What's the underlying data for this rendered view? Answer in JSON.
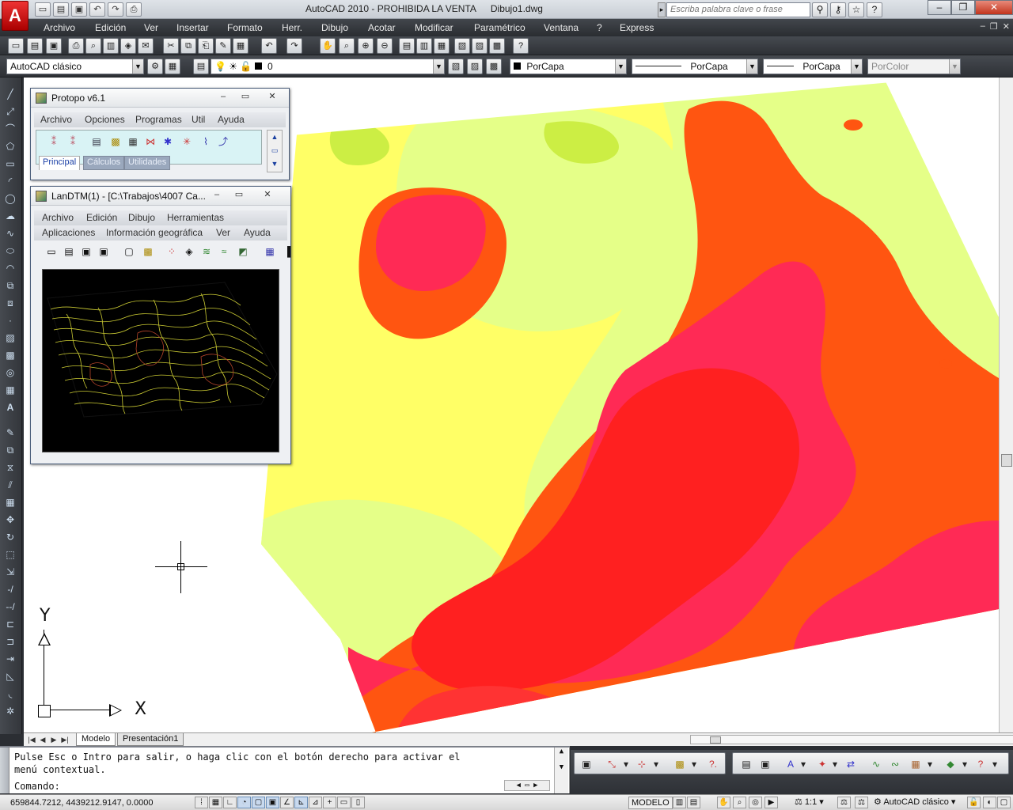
{
  "app": {
    "logo": "A",
    "title": "AutoCAD 2010 - PROHIBIDA LA VENTA",
    "document": "Dibujo1.dwg",
    "search_placeholder": "Escriba palabra clave o frase"
  },
  "menu": [
    "Archivo",
    "Edición",
    "Ver",
    "Insertar",
    "Formato",
    "Herr.",
    "Dibujo",
    "Acotar",
    "Modificar",
    "Paramétrico",
    "Ventana",
    "?",
    "Express"
  ],
  "toolbar": {
    "workspace": "AutoCAD clásico",
    "layer": "0",
    "color": "PorCapa",
    "linetype": "PorCapa",
    "lineweight": "PorCapa",
    "plotstyle": "PorColor"
  },
  "protopo": {
    "title": "Protopo v6.1",
    "menu": [
      "Archivo",
      "Opciones",
      "Programas",
      "Util",
      "Ayuda"
    ],
    "tabs": [
      "Principal",
      "Cálculos",
      "Utilidades"
    ]
  },
  "landtm": {
    "title": "LanDTM(1) - [C:\\Trabajos\\4007 Ca...",
    "menu_row1": [
      "Archivo",
      "Edición",
      "Dibujo",
      "Herramientas"
    ],
    "menu_row2": [
      "Aplicaciones",
      "Información geográfica",
      "Ver",
      "Ayuda"
    ]
  },
  "ucs": {
    "x_label": "X",
    "y_label": "Y"
  },
  "layout_tabs": [
    "Modelo",
    "Presentación1"
  ],
  "command": {
    "line1": "Pulse Esc o Intro para salir, o haga clic con el botón derecho para activar el",
    "line2": "menú contextual.",
    "prompt": "Comando:"
  },
  "status": {
    "coords": "659844.7212, 4439212.9147, 0.0000",
    "space": "MODELO",
    "scale": "1:1",
    "workspace": "AutoCAD clásico"
  },
  "map_colors": {
    "background": "#ffffff",
    "band_0": "#ffff66",
    "band_1": "#e5ff88",
    "band_2": "#ccee44",
    "band_3": "#ff5511",
    "band_4": "#ff2a55",
    "band_5": "#ff2020",
    "band_6": "#ff3333"
  }
}
